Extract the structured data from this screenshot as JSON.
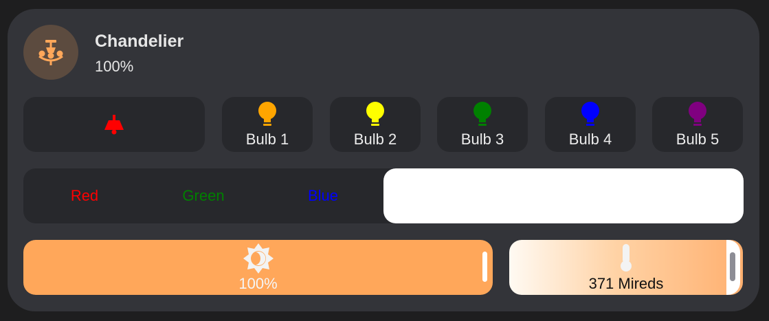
{
  "entity": {
    "name": "Chandelier",
    "state": "100%",
    "icon": "chandelier-icon",
    "icon_color": "#ffa75a",
    "icon_bg": "#5c4b3f"
  },
  "buttons": {
    "effect": {
      "icon": "bell-icon",
      "color": "#ff0000"
    },
    "bulbs": [
      {
        "label": "Bulb 1",
        "icon": "lightbulb-icon",
        "color": "#ffa500"
      },
      {
        "label": "Bulb 2",
        "icon": "lightbulb-icon",
        "color": "#ffff00"
      },
      {
        "label": "Bulb 3",
        "icon": "lightbulb-icon",
        "color": "#008000"
      },
      {
        "label": "Bulb 4",
        "icon": "lightbulb-icon",
        "color": "#0000ff"
      },
      {
        "label": "Bulb 5",
        "icon": "lightbulb-icon",
        "color": "#800080"
      }
    ]
  },
  "color_selector": {
    "options": [
      {
        "label": "Red",
        "color": "#ff0000"
      },
      {
        "label": "Green",
        "color": "#008000"
      },
      {
        "label": "Blue",
        "color": "#0000ff"
      },
      {
        "label": "",
        "color": "#ffffff"
      }
    ],
    "selected_index": 3
  },
  "brightness": {
    "value_label": "100%",
    "value": 1.0,
    "icon": "brightness-auto-icon",
    "color": "#ffa75a"
  },
  "color_temp": {
    "value_label": "371 Mireds",
    "icon": "thermometer-icon"
  }
}
